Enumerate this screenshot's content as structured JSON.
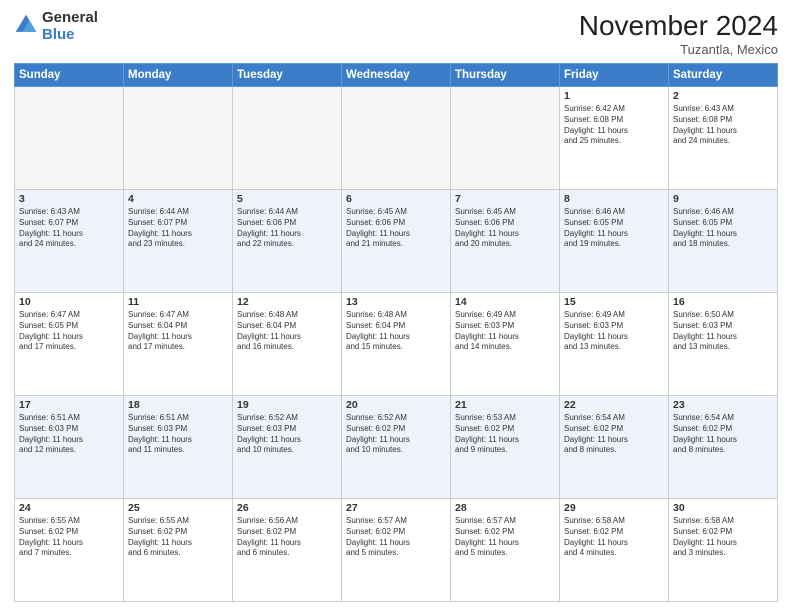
{
  "logo": {
    "general": "General",
    "blue": "Blue"
  },
  "header": {
    "month": "November 2024",
    "location": "Tuzantla, Mexico"
  },
  "weekdays": [
    "Sunday",
    "Monday",
    "Tuesday",
    "Wednesday",
    "Thursday",
    "Friday",
    "Saturday"
  ],
  "weeks": [
    [
      {
        "day": "",
        "info": ""
      },
      {
        "day": "",
        "info": ""
      },
      {
        "day": "",
        "info": ""
      },
      {
        "day": "",
        "info": ""
      },
      {
        "day": "",
        "info": ""
      },
      {
        "day": "1",
        "info": "Sunrise: 6:42 AM\nSunset: 6:08 PM\nDaylight: 11 hours\nand 25 minutes."
      },
      {
        "day": "2",
        "info": "Sunrise: 6:43 AM\nSunset: 6:08 PM\nDaylight: 11 hours\nand 24 minutes."
      }
    ],
    [
      {
        "day": "3",
        "info": "Sunrise: 6:43 AM\nSunset: 6:07 PM\nDaylight: 11 hours\nand 24 minutes."
      },
      {
        "day": "4",
        "info": "Sunrise: 6:44 AM\nSunset: 6:07 PM\nDaylight: 11 hours\nand 23 minutes."
      },
      {
        "day": "5",
        "info": "Sunrise: 6:44 AM\nSunset: 6:06 PM\nDaylight: 11 hours\nand 22 minutes."
      },
      {
        "day": "6",
        "info": "Sunrise: 6:45 AM\nSunset: 6:06 PM\nDaylight: 11 hours\nand 21 minutes."
      },
      {
        "day": "7",
        "info": "Sunrise: 6:45 AM\nSunset: 6:06 PM\nDaylight: 11 hours\nand 20 minutes."
      },
      {
        "day": "8",
        "info": "Sunrise: 6:46 AM\nSunset: 6:05 PM\nDaylight: 11 hours\nand 19 minutes."
      },
      {
        "day": "9",
        "info": "Sunrise: 6:46 AM\nSunset: 6:05 PM\nDaylight: 11 hours\nand 18 minutes."
      }
    ],
    [
      {
        "day": "10",
        "info": "Sunrise: 6:47 AM\nSunset: 6:05 PM\nDaylight: 11 hours\nand 17 minutes."
      },
      {
        "day": "11",
        "info": "Sunrise: 6:47 AM\nSunset: 6:04 PM\nDaylight: 11 hours\nand 17 minutes."
      },
      {
        "day": "12",
        "info": "Sunrise: 6:48 AM\nSunset: 6:04 PM\nDaylight: 11 hours\nand 16 minutes."
      },
      {
        "day": "13",
        "info": "Sunrise: 6:48 AM\nSunset: 6:04 PM\nDaylight: 11 hours\nand 15 minutes."
      },
      {
        "day": "14",
        "info": "Sunrise: 6:49 AM\nSunset: 6:03 PM\nDaylight: 11 hours\nand 14 minutes."
      },
      {
        "day": "15",
        "info": "Sunrise: 6:49 AM\nSunset: 6:03 PM\nDaylight: 11 hours\nand 13 minutes."
      },
      {
        "day": "16",
        "info": "Sunrise: 6:50 AM\nSunset: 6:03 PM\nDaylight: 11 hours\nand 13 minutes."
      }
    ],
    [
      {
        "day": "17",
        "info": "Sunrise: 6:51 AM\nSunset: 6:03 PM\nDaylight: 11 hours\nand 12 minutes."
      },
      {
        "day": "18",
        "info": "Sunrise: 6:51 AM\nSunset: 6:03 PM\nDaylight: 11 hours\nand 11 minutes."
      },
      {
        "day": "19",
        "info": "Sunrise: 6:52 AM\nSunset: 6:03 PM\nDaylight: 11 hours\nand 10 minutes."
      },
      {
        "day": "20",
        "info": "Sunrise: 6:52 AM\nSunset: 6:02 PM\nDaylight: 11 hours\nand 10 minutes."
      },
      {
        "day": "21",
        "info": "Sunrise: 6:53 AM\nSunset: 6:02 PM\nDaylight: 11 hours\nand 9 minutes."
      },
      {
        "day": "22",
        "info": "Sunrise: 6:54 AM\nSunset: 6:02 PM\nDaylight: 11 hours\nand 8 minutes."
      },
      {
        "day": "23",
        "info": "Sunrise: 6:54 AM\nSunset: 6:02 PM\nDaylight: 11 hours\nand 8 minutes."
      }
    ],
    [
      {
        "day": "24",
        "info": "Sunrise: 6:55 AM\nSunset: 6:02 PM\nDaylight: 11 hours\nand 7 minutes."
      },
      {
        "day": "25",
        "info": "Sunrise: 6:55 AM\nSunset: 6:02 PM\nDaylight: 11 hours\nand 6 minutes."
      },
      {
        "day": "26",
        "info": "Sunrise: 6:56 AM\nSunset: 6:02 PM\nDaylight: 11 hours\nand 6 minutes."
      },
      {
        "day": "27",
        "info": "Sunrise: 6:57 AM\nSunset: 6:02 PM\nDaylight: 11 hours\nand 5 minutes."
      },
      {
        "day": "28",
        "info": "Sunrise: 6:57 AM\nSunset: 6:02 PM\nDaylight: 11 hours\nand 5 minutes."
      },
      {
        "day": "29",
        "info": "Sunrise: 6:58 AM\nSunset: 6:02 PM\nDaylight: 11 hours\nand 4 minutes."
      },
      {
        "day": "30",
        "info": "Sunrise: 6:58 AM\nSunset: 6:02 PM\nDaylight: 11 hours\nand 3 minutes."
      }
    ]
  ]
}
